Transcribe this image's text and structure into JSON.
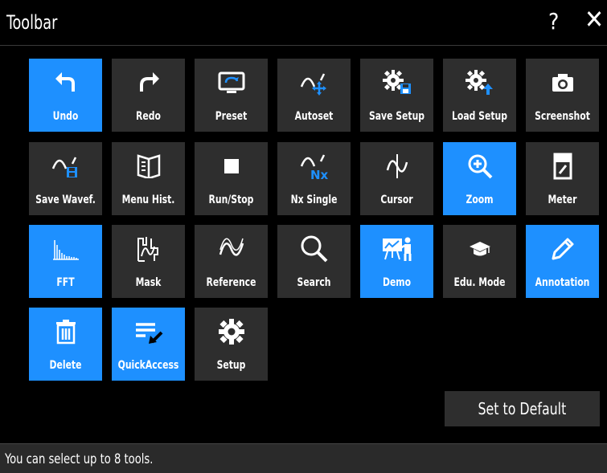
{
  "window": {
    "title": "Toolbar",
    "help_label": "?",
    "close_label": "✕"
  },
  "tools": [
    {
      "label": "Undo",
      "icon": "undo-icon",
      "selected": true
    },
    {
      "label": "Redo",
      "icon": "redo-icon",
      "selected": false
    },
    {
      "label": "Preset",
      "icon": "preset-icon",
      "selected": false
    },
    {
      "label": "Autoset",
      "icon": "autoset-icon",
      "selected": false
    },
    {
      "label": "Save Setup",
      "icon": "save-setup-icon",
      "selected": false
    },
    {
      "label": "Load Setup",
      "icon": "load-setup-icon",
      "selected": false
    },
    {
      "label": "Screenshot",
      "icon": "camera-icon",
      "selected": false
    },
    {
      "label": "Save Wavef.",
      "icon": "save-waveform-icon",
      "selected": false
    },
    {
      "label": "Menu Hist.",
      "icon": "menu-history-icon",
      "selected": false
    },
    {
      "label": "Run/Stop",
      "icon": "stop-icon",
      "selected": false
    },
    {
      "label": "Nx Single",
      "icon": "nx-single-icon",
      "selected": false
    },
    {
      "label": "Cursor",
      "icon": "cursor-icon",
      "selected": false
    },
    {
      "label": "Zoom",
      "icon": "zoom-icon",
      "selected": true
    },
    {
      "label": "Meter",
      "icon": "meter-icon",
      "selected": false
    },
    {
      "label": "FFT",
      "icon": "fft-icon",
      "selected": true
    },
    {
      "label": "Mask",
      "icon": "mask-icon",
      "selected": false
    },
    {
      "label": "Reference",
      "icon": "reference-icon",
      "selected": false
    },
    {
      "label": "Search",
      "icon": "search-icon",
      "selected": false
    },
    {
      "label": "Demo",
      "icon": "demo-icon",
      "selected": true
    },
    {
      "label": "Edu. Mode",
      "icon": "graduation-cap-icon",
      "selected": false
    },
    {
      "label": "Annotation",
      "icon": "pencil-icon",
      "selected": true
    },
    {
      "label": "Delete",
      "icon": "trash-icon",
      "selected": true
    },
    {
      "label": "QuickAccess",
      "icon": "quick-access-icon",
      "selected": true
    },
    {
      "label": "Setup",
      "icon": "gear-icon",
      "selected": false
    }
  ],
  "nx_text": "Nx",
  "default_button": {
    "label": "Set to Default"
  },
  "status": {
    "text": "You can select up to 8 tools."
  },
  "colors": {
    "selected": "#1e90ff",
    "tile": "#2e2e2e",
    "background": "#000000",
    "accent_icon": "#1e90ff"
  }
}
